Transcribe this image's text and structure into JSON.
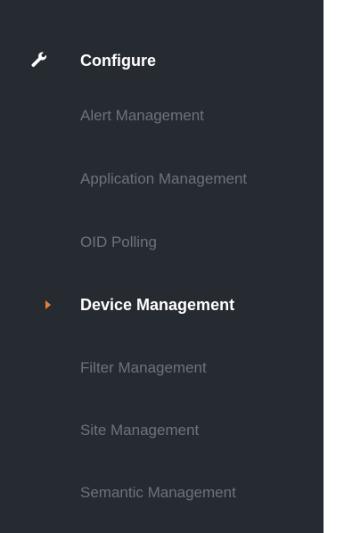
{
  "sidebar": {
    "section": {
      "label": "Configure",
      "icon": "wrench-icon"
    },
    "items": [
      {
        "label": "Alert Management",
        "active": false
      },
      {
        "label": "Application Management",
        "active": false
      },
      {
        "label": "OID Polling",
        "active": false
      },
      {
        "label": "Device Management",
        "active": true
      },
      {
        "label": "Filter Management",
        "active": false
      },
      {
        "label": "Site Management",
        "active": false
      },
      {
        "label": "Semantic Management",
        "active": false
      }
    ]
  },
  "colors": {
    "background": "#252b31",
    "text_active": "#ffffff",
    "text_inactive": "#6b737c",
    "accent": "#e67e3a"
  }
}
